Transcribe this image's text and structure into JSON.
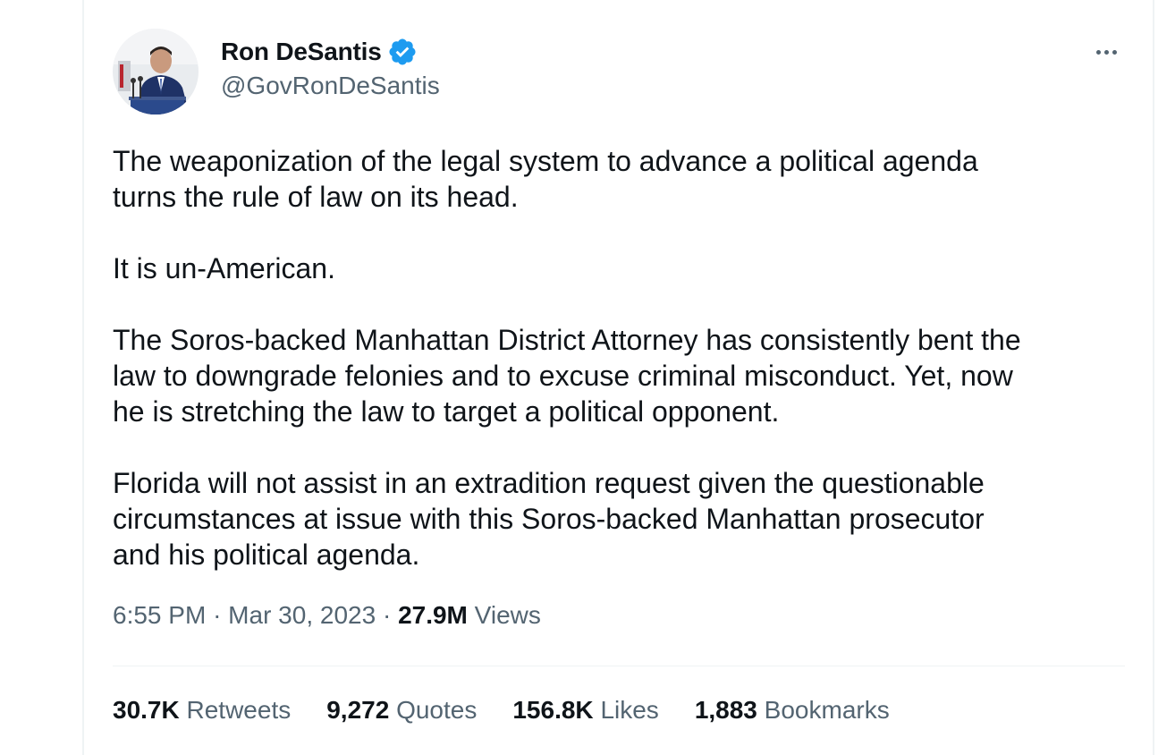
{
  "author": {
    "display_name": "Ron DeSantis",
    "handle": "@GovRonDeSantis",
    "verified": true,
    "verified_color": "#1d9bf0"
  },
  "more_icon": "more-horizontal-icon",
  "tweet": {
    "paragraphs": [
      "The weaponization of the legal system to advance a political agenda\nturns the rule of law on its head.",
      "It is un-American.",
      "The Soros-backed Manhattan District Attorney has consistently bent the\nlaw to downgrade felonies and to excuse criminal misconduct. Yet, now\nhe is stretching the law to target a political opponent.",
      "Florida will not assist in an extradition request given the questionable\ncircumstances at issue with this Soros-backed Manhattan prosecutor\nand his political agenda."
    ]
  },
  "meta": {
    "time": "6:55 PM",
    "separator": "·",
    "date": "Mar 30, 2023",
    "views_count": "27.9M",
    "views_label": "Views"
  },
  "stats": [
    {
      "count": "30.7K",
      "label": "Retweets"
    },
    {
      "count": "9,272",
      "label": "Quotes"
    },
    {
      "count": "156.8K",
      "label": "Likes"
    },
    {
      "count": "1,883",
      "label": "Bookmarks"
    }
  ],
  "colors": {
    "text_primary": "#0f1419",
    "text_secondary": "#536471",
    "divider": "#eff3f4"
  }
}
